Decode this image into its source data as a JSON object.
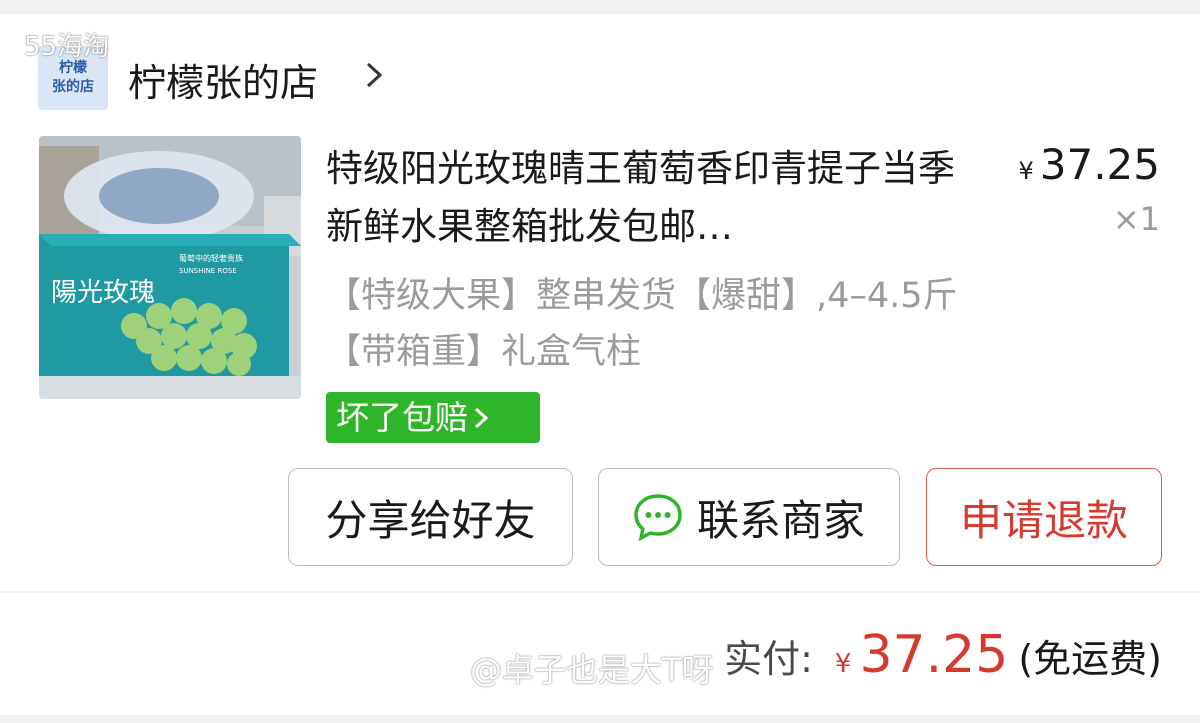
{
  "watermark_top": "55海淘",
  "shop": {
    "logo_line1": "柠檬",
    "logo_line2": "张的店",
    "name": "柠檬张的店"
  },
  "product": {
    "title": "特级阳光玫瑰晴王葡萄香印青提子当季新鲜水果整箱批发包邮…",
    "price_symbol": "¥",
    "price": "37.25",
    "quantity": "×1",
    "specs": "【特级大果】整串发货【爆甜】,4–4.5斤【带箱重】礼盒气柱",
    "badge": "坏了包赔",
    "image_box_text": "陽光玫瑰",
    "image_box_small": "葡萄中的轻奢贵族",
    "image_box_en": "SUNSHINE ROSE"
  },
  "actions": {
    "share": "分享给好友",
    "contact": "联系商家",
    "refund": "申请退款"
  },
  "summary": {
    "label": "实付:",
    "symbol": "¥",
    "amount": "37.25",
    "shipping": "(免运费)"
  },
  "watermark_bottom": "@卓子也是大T呀",
  "colors": {
    "accent_red": "#d63a2f",
    "badge_green": "#2fb529",
    "muted_text": "#9b9b9b"
  }
}
